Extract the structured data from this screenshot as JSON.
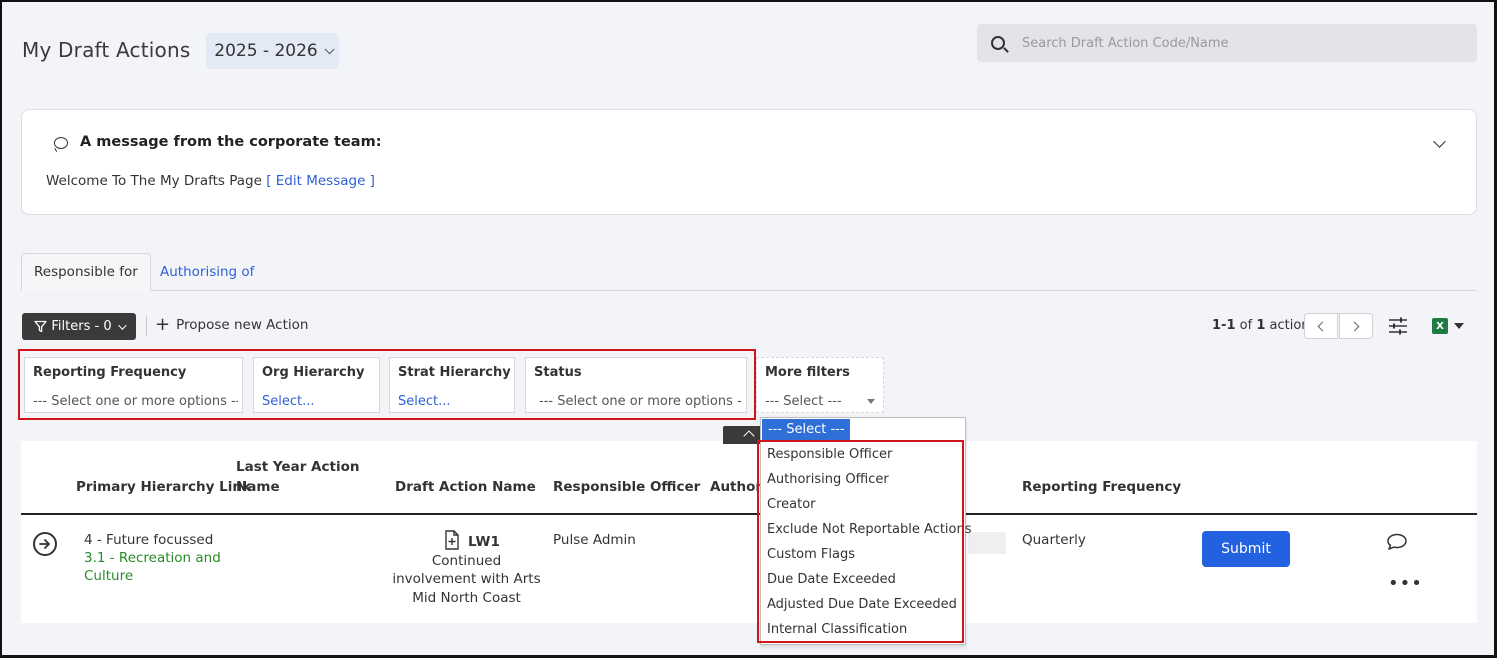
{
  "header": {
    "title": "My Draft Actions",
    "year": "2025 - 2026",
    "search_placeholder": "Search Draft Action Code/Name"
  },
  "message": {
    "title": "A message from the corporate team:",
    "body": "Welcome To The My Drafts Page",
    "edit_link": "[ Edit Message ]"
  },
  "tabs": [
    {
      "label": "Responsible for",
      "active": true
    },
    {
      "label": "Authorising of",
      "active": false
    }
  ],
  "toolbar": {
    "filters_label": "Filters - 0",
    "propose_label": "Propose new Action",
    "pager_range": "1-1",
    "pager_of": "of",
    "pager_count": "1",
    "pager_unit": "action"
  },
  "filters": [
    {
      "label": "Reporting Frequency",
      "value": "--- Select one or more options ---"
    },
    {
      "label": "Org Hierarchy",
      "value": "Select..."
    },
    {
      "label": "Strat Hierarchy",
      "value": "Select..."
    },
    {
      "label": "Status",
      "value": "--- Select one or more options ---"
    },
    {
      "label": "More filters",
      "value": "--- Select ---"
    }
  ],
  "table": {
    "headers": {
      "primary": "Primary Hierarchy Link",
      "last_year_1": "Last Year Action",
      "last_year_2": "Name",
      "draft": "Draft Action Name",
      "responsible": "Responsible Officer",
      "author": "Author",
      "frequency": "Reporting Frequency"
    },
    "row": {
      "hier_1": "4 - Future focussed",
      "hier_2a": "3.1 - Recreation and",
      "hier_2b": "Culture",
      "code": "LW1",
      "name_1": "Continued",
      "name_2": "involvement with Arts",
      "name_3": "Mid North Coast",
      "responsible": "Pulse Admin",
      "frequency": "Quarterly",
      "submit": "Submit"
    }
  },
  "dropdown": {
    "selected": "--- Select ---",
    "items": [
      "Responsible Officer",
      "Authorising Officer",
      "Creator",
      "Exclude Not Reportable Actions",
      "Custom Flags",
      "Due Date Exceeded",
      "Adjusted Due Date Exceeded",
      "Internal Classification"
    ]
  },
  "colors": {
    "accent": "#2262e0",
    "link": "#2f5fd6",
    "green": "#2a8a2a",
    "highlight": "#d0141a",
    "dark_button": "#3a3a3a"
  }
}
